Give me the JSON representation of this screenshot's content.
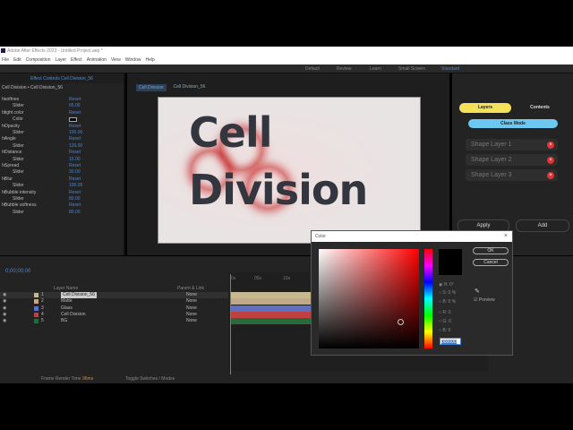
{
  "app": {
    "title": "Adobe After Effects 2023 - Untitled Project.aep *"
  },
  "menu": [
    "File",
    "Edit",
    "Composition",
    "Layer",
    "Effect",
    "Animation",
    "View",
    "Window",
    "Help"
  ],
  "workspaces": [
    "Default",
    "Review",
    "Learn",
    "Small Screen",
    "Standard"
  ],
  "effect_controls": {
    "tab": "Effect Controls Cell Division_56",
    "header": "Cell Division • Cell Division_56",
    "rows": [
      {
        "name": "softnes",
        "value": "Reset"
      },
      {
        "name": "Slider",
        "value": "65.00"
      },
      {
        "name": "light color",
        "value": "Reset"
      },
      {
        "name": "Color",
        "value": ""
      },
      {
        "name": "Opacity",
        "value": "Reset"
      },
      {
        "name": "Slider",
        "value": "100.00"
      },
      {
        "name": "Angle",
        "value": "Reset"
      },
      {
        "name": "Slider",
        "value": "120.00"
      },
      {
        "name": "Distance",
        "value": "Reset"
      },
      {
        "name": "Slider",
        "value": "15.00"
      },
      {
        "name": "Spread",
        "value": "Reset"
      },
      {
        "name": "Slider",
        "value": "30.00"
      },
      {
        "name": "Blur",
        "value": "Reset"
      },
      {
        "name": "Slider",
        "value": "100.00"
      },
      {
        "name": "Bubble intensity",
        "value": "Reset"
      },
      {
        "name": "Slider",
        "value": "80.00"
      },
      {
        "name": "Bubble softness",
        "value": "Reset"
      },
      {
        "name": "Slider",
        "value": "80.00"
      }
    ]
  },
  "comp": {
    "tabs": [
      "Cell Division",
      "Cell Division_56"
    ],
    "title_line1": "Cell",
    "title_line2": "Division"
  },
  "plugin": {
    "tab_layers": "Layers",
    "tab_contents": "Contents",
    "class_mode": "Class Mode",
    "layers": [
      "Shape Layer 1",
      "Shape Layer 2",
      "Shape Layer 3"
    ],
    "apply": "Apply",
    "add": "Add"
  },
  "timeline": {
    "timecode": "0;00;00;00",
    "col_layer_name": "Layer Name",
    "col_parent": "Parent & Link",
    "layers": [
      {
        "num": "1",
        "name": "Cell Division_56",
        "parent": "None",
        "color": "#c8b890"
      },
      {
        "num": "2",
        "name": "Matte",
        "parent": "None",
        "color": "#c0a888"
      },
      {
        "num": "3",
        "name": "Glass",
        "parent": "None",
        "color": "#6070c0"
      },
      {
        "num": "4",
        "name": "Cell Division",
        "parent": "None",
        "color": "#c04040"
      },
      {
        "num": "5",
        "name": "BG",
        "parent": "None",
        "color": "#2a6a3a"
      }
    ],
    "ruler": [
      "0s",
      "05s",
      "10s"
    ],
    "frame_render_label": "Frame Render Time",
    "frame_render_value": "96ms",
    "toggle": "Toggle Switches / Modes"
  },
  "color_dialog": {
    "title": "Color",
    "ok": "OK",
    "cancel": "Cancel",
    "fields": [
      "H: 0°",
      "S: 0 %",
      "B: 0 %",
      "R: 0",
      "G: 0",
      "B: 0"
    ],
    "hex": "000000",
    "preview_label": "Preview",
    "preview_checked": true
  }
}
